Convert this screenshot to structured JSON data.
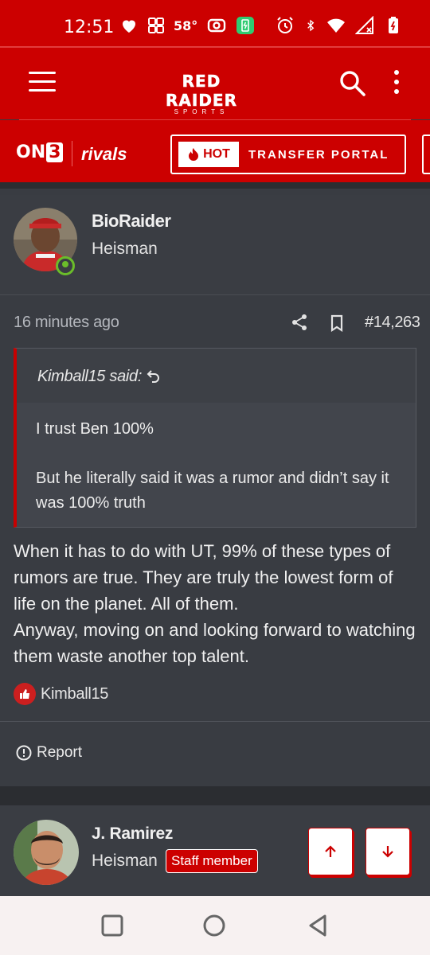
{
  "status_bar": {
    "time": "12:51",
    "temperature": "58°",
    "icons": [
      "heart-icon",
      "grid-icon",
      "cast-icon",
      "battery-saver-icon",
      "alarm-icon",
      "bluetooth-icon",
      "wifi-icon",
      "signal-icon",
      "battery-icon"
    ]
  },
  "header": {
    "brand_main": "RED RAIDER",
    "brand_sub": "SPORTS",
    "menu_icon": "hamburger-icon",
    "search_icon": "search-icon",
    "more_icon": "more-vertical-icon"
  },
  "partner_bar": {
    "on3_prefix": "ON",
    "on3_number": "3",
    "rivals": "rivals",
    "hot_label": "HOT",
    "portal_label": "TRANSFER PORTAL"
  },
  "post": {
    "username": "BioRaider",
    "user_title": "Heisman",
    "time_ago": "16 minutes ago",
    "post_number": "#14,263",
    "quote": {
      "author": "Kimball15 said:",
      "paragraphs": [
        "I trust Ben 100%",
        "But he literally said it was a rumor and didn’t say it was 100% truth"
      ]
    },
    "message_lines": [
      "When it has to do with UT, 99% of these types of rumors are true. They are truly the lowest form of life on the planet. All of them.",
      "Anyway, moving on and looking forward to watching them waste another top talent."
    ],
    "reaction_user": "Kimball15",
    "report_label": "Report"
  },
  "next_post": {
    "username": "J. Ramirez",
    "user_title": "Heisman",
    "badge": "Staff member"
  },
  "colors": {
    "brand_red": "#cc0000",
    "background": "#393c42",
    "online_green": "#6bbd2a"
  }
}
